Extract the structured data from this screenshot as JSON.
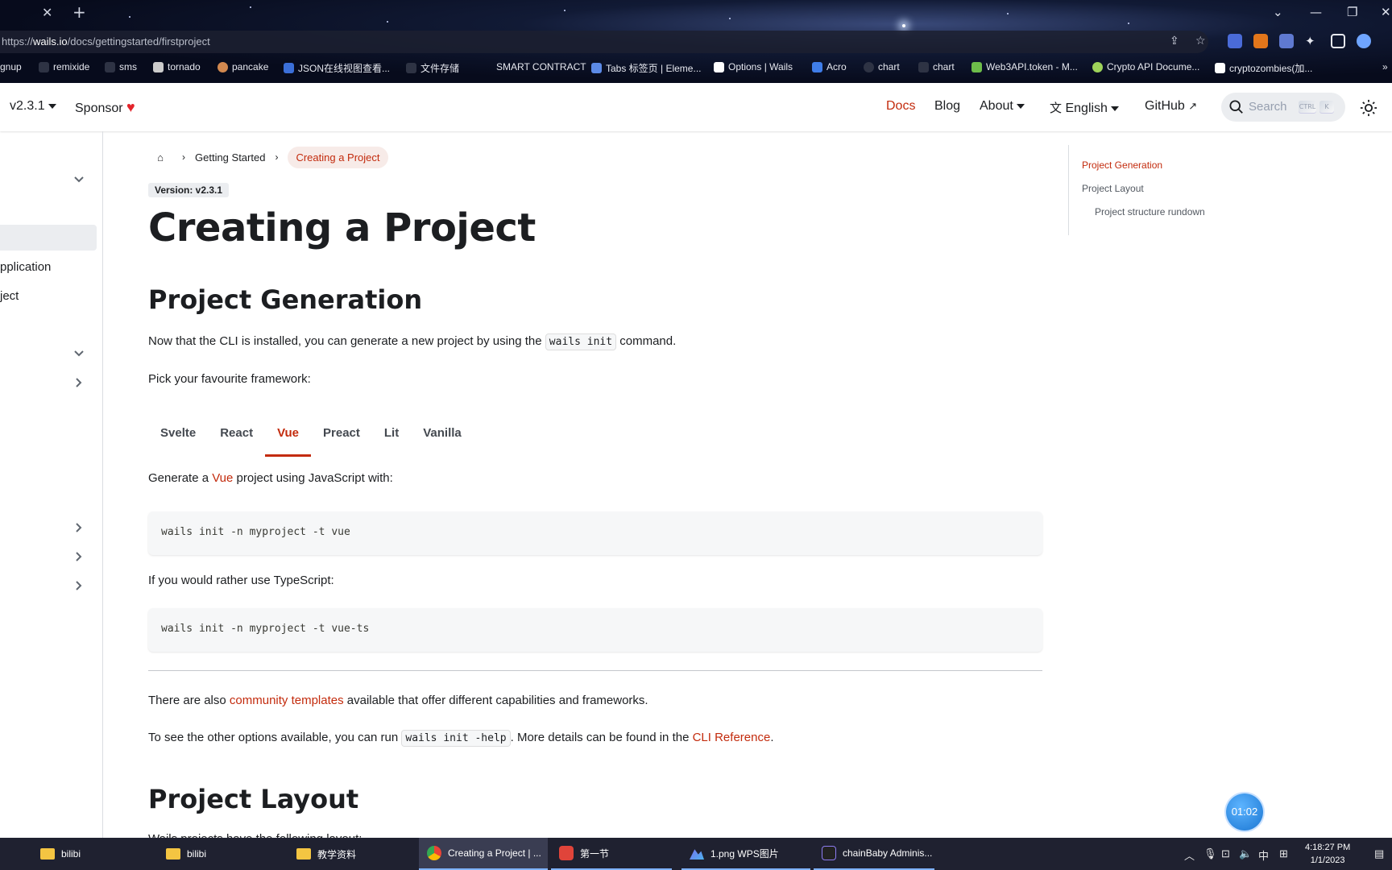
{
  "browser": {
    "url_prefix": "https://",
    "url_host": "wails.io",
    "url_path": "/docs/gettingstarted/firstproject",
    "bookmarks": [
      "gnup",
      "remixide",
      "sms",
      "tornado",
      "pancake",
      "JSON在线视图查看...",
      "文件存储",
      "SMART CONTRACT",
      "Tabs 标签页 | Eleme...",
      "Options | Wails",
      "Acro",
      "chart",
      "chart",
      "Web3API.token - M...",
      "Crypto API Docume...",
      "cryptozombies(加..."
    ]
  },
  "navbar": {
    "version": "v2.3.1",
    "sponsor": "Sponsor",
    "docs": "Docs",
    "blog": "Blog",
    "about": "About",
    "language": "English",
    "github": "GitHub",
    "search_placeholder": "Search",
    "kbd_ctrl": "CTRL",
    "kbd_k": "K"
  },
  "sidebar": {
    "item_application": "pplication",
    "item_project": "ject"
  },
  "breadcrumbs": {
    "parent": "Getting Started",
    "current": "Creating a Project"
  },
  "doc": {
    "version_badge": "Version: v2.3.1",
    "title": "Creating a Project",
    "section1_title": "Project Generation",
    "intro_before": "Now that the CLI is installed, you can generate a new project by using the ",
    "intro_code": "wails init",
    "intro_after": " command.",
    "pick_framework": "Pick your favourite framework:",
    "tabs": [
      "Svelte",
      "React",
      "Vue",
      "Preact",
      "Lit",
      "Vanilla"
    ],
    "active_tab": "Vue",
    "generate_before": "Generate a ",
    "generate_link": "Vue",
    "generate_after": " project using JavaScript with:",
    "code_js": "wails init -n myproject -t vue",
    "typescript_text": "If you would rather use TypeScript:",
    "code_ts": "wails init -n myproject -t vue-ts",
    "community_before": "There are also ",
    "community_link": "community templates",
    "community_after": " available that offer different capabilities and frameworks.",
    "options_before": "To see the other options available, you can run ",
    "options_code": "wails init -help",
    "options_middle": ". More details can be found in the ",
    "options_link": "CLI Reference",
    "options_after": ".",
    "section2_title": "Project Layout",
    "section2_partial": "Wails projects have the following layout:"
  },
  "toc": {
    "item1": "Project Generation",
    "item2": "Project Layout",
    "item3": "Project structure rundown"
  },
  "timer": "01:02",
  "taskbar": {
    "items": [
      "bilibi",
      "bilibi",
      "教学资料",
      "Creating a Project | ...",
      "第一节",
      "1.png  WPS图片",
      "chainBaby Adminis..."
    ],
    "ime": "中",
    "time": "4:18:27 PM",
    "date": "1/1/2023"
  },
  "colors": {
    "accent": "#c32b0d",
    "taskbar": "#1f2130"
  }
}
